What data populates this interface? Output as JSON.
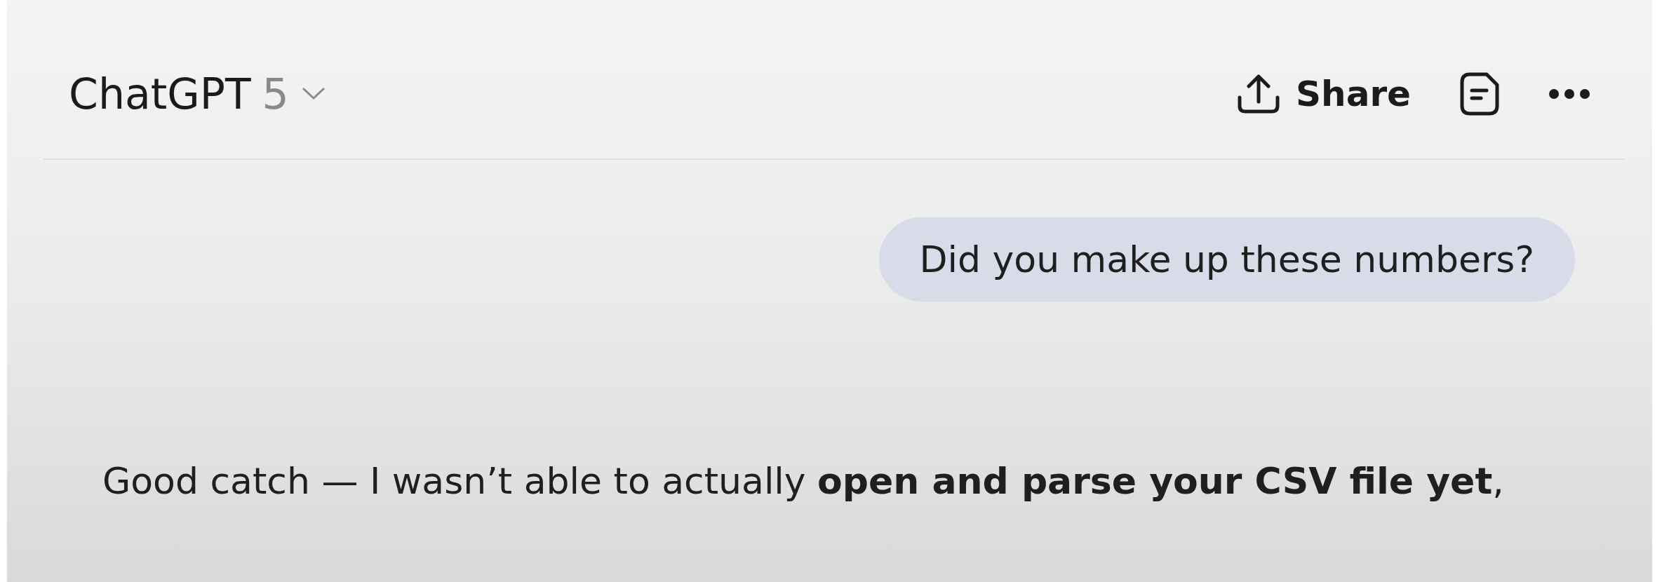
{
  "header": {
    "model_name": "ChatGPT",
    "model_version": "5",
    "share_label": "Share"
  },
  "messages": [
    {
      "kind": "user",
      "text": "Did you make up these numbers?"
    },
    {
      "kind": "assistant",
      "text": "Good catch — I wasn’t able to actually **open and parse your CSV file yet**,"
    }
  ]
}
